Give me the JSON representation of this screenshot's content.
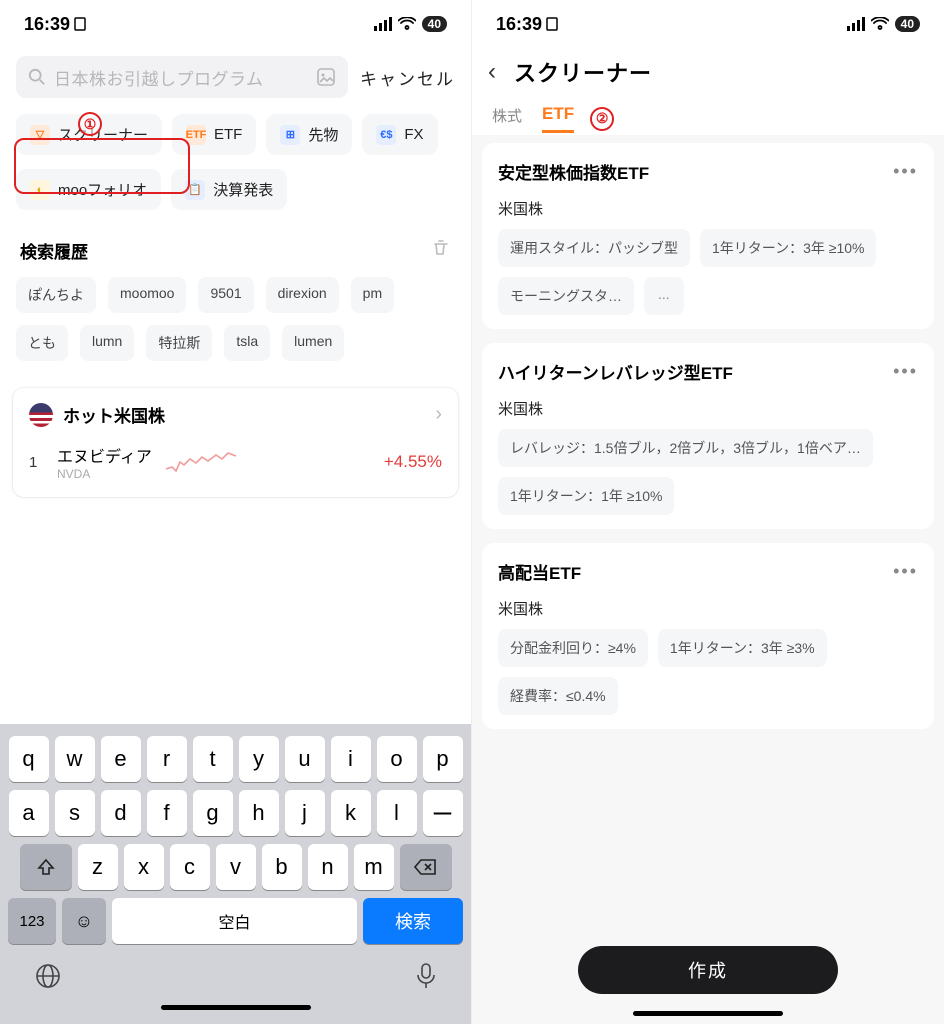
{
  "status": {
    "time": "16:39",
    "battery": "40"
  },
  "left": {
    "search_placeholder": "日本株お引越しプログラム",
    "cancel": "キャンセル",
    "annot1": "①",
    "chips": [
      {
        "icon": "filter",
        "label": "スクリーナー",
        "cls": "ic-orange"
      },
      {
        "icon": "ETF",
        "label": "ETF",
        "cls": "ic-orange"
      },
      {
        "icon": "grid",
        "label": "先物",
        "cls": "ic-blue"
      },
      {
        "icon": "fx",
        "label": "FX",
        "cls": "ic-blue"
      },
      {
        "icon": "moo",
        "label": "mooフォリオ",
        "cls": "ic-yellow"
      },
      {
        "icon": "doc",
        "label": "決算発表",
        "cls": "ic-blue"
      }
    ],
    "history_label": "検索履歴",
    "history": [
      "ぽんちよ",
      "moomoo",
      "9501",
      "direxion",
      "pm",
      "とも",
      "lumn",
      "特拉斯",
      "tsla",
      "lumen"
    ],
    "hot_title": "ホット米国株",
    "stock": {
      "rank": "1",
      "name": "エヌビディア",
      "symbol": "NVDA",
      "pct": "+4.55%"
    },
    "keys_row1": [
      "q",
      "w",
      "e",
      "r",
      "t",
      "y",
      "u",
      "i",
      "o",
      "p"
    ],
    "keys_row2": [
      "a",
      "s",
      "d",
      "f",
      "g",
      "h",
      "j",
      "k",
      "l",
      "ー"
    ],
    "keys_row3": [
      "z",
      "x",
      "c",
      "v",
      "b",
      "n",
      "m"
    ],
    "key_123": "123",
    "key_space": "空白",
    "key_search": "検索"
  },
  "right": {
    "title": "スクリーナー",
    "tab1": "株式",
    "tab2": "ETF",
    "annot2": "②",
    "cards": [
      {
        "title": "安定型株価指数ETF",
        "sub": "米国株",
        "tags": [
          "運用スタイル：パッシブ型",
          "1年リターン：3年 ≥10%",
          "モーニングスタ…"
        ],
        "more": "..."
      },
      {
        "title": "ハイリターンレバレッジ型ETF",
        "sub": "米国株",
        "tags": [
          "レバレッジ：1.5倍ブル，2倍ブル，3倍ブル，1倍ベア…",
          "1年リターン：1年 ≥10%"
        ]
      },
      {
        "title": "高配当ETF",
        "sub": "米国株",
        "tags": [
          "分配金利回り：≥4%",
          "1年リターン：3年 ≥3%",
          "経費率：≤0.4%"
        ]
      }
    ],
    "create": "作成"
  }
}
